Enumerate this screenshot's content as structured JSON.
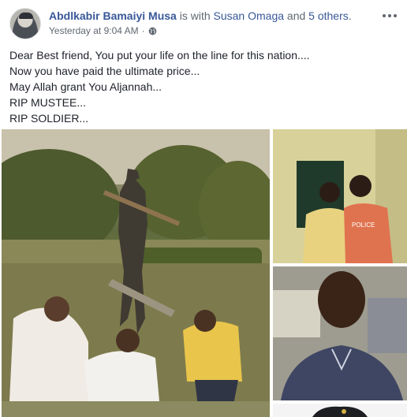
{
  "post": {
    "author": "Abdlkabir Bamaiyi Musa",
    "with_text": " is with ",
    "tagged": "Susan Omaga",
    "and_text": " and ",
    "others": "5 others",
    "period": ".",
    "timestamp": "Yesterday at 9:04 AM",
    "separator": "·",
    "privacy_icon": "globe-icon",
    "menu_icon": "more-options-icon"
  },
  "message": {
    "lines": [
      "Dear Best friend, You put your life on the line for this nation....",
      "Now you have paid the ultimate price...",
      "May Allah grant You Aljannah...",
      "RIP MUSTEE...",
      "RIP SOLDIER..."
    ]
  },
  "photos": {
    "main_shirt_text": "POLICE",
    "colors": {
      "link": "#385898",
      "meta": "#606770",
      "text": "#1d2129"
    }
  }
}
